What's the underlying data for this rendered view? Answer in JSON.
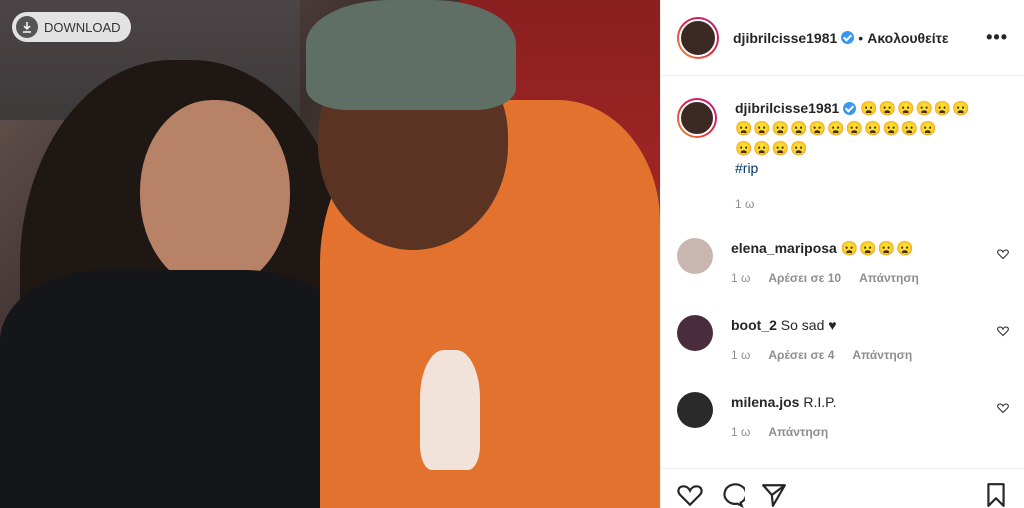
{
  "download": {
    "label": "DOWNLOAD"
  },
  "post": {
    "author": "djibrilcisse1981",
    "follow_label": "Ακολουθείτε",
    "separator": "•",
    "more": "•••",
    "caption_emoji_line1": "😦😦😦😦😦😦",
    "caption_emoji_line2": "😦😦😦😦😦😦😦😦😦😦😦",
    "caption_emoji_line3": "😦😦😦😦",
    "hashtag": "#rip",
    "time": "1 ω"
  },
  "comments": [
    {
      "user": "elena_mariposa",
      "text": "😦😦😦😦",
      "time": "1 ω",
      "likes": "Αρέσει σε 10",
      "reply": "Απάντηση"
    },
    {
      "user": "boot_2",
      "text": "So sad ♥",
      "time": "1 ω",
      "likes": "Αρέσει σε 4",
      "reply": "Απάντηση"
    },
    {
      "user": "milena.jos",
      "text": "R.I.P.",
      "time": "1 ω",
      "likes": "",
      "reply": "Απάντηση"
    }
  ]
}
